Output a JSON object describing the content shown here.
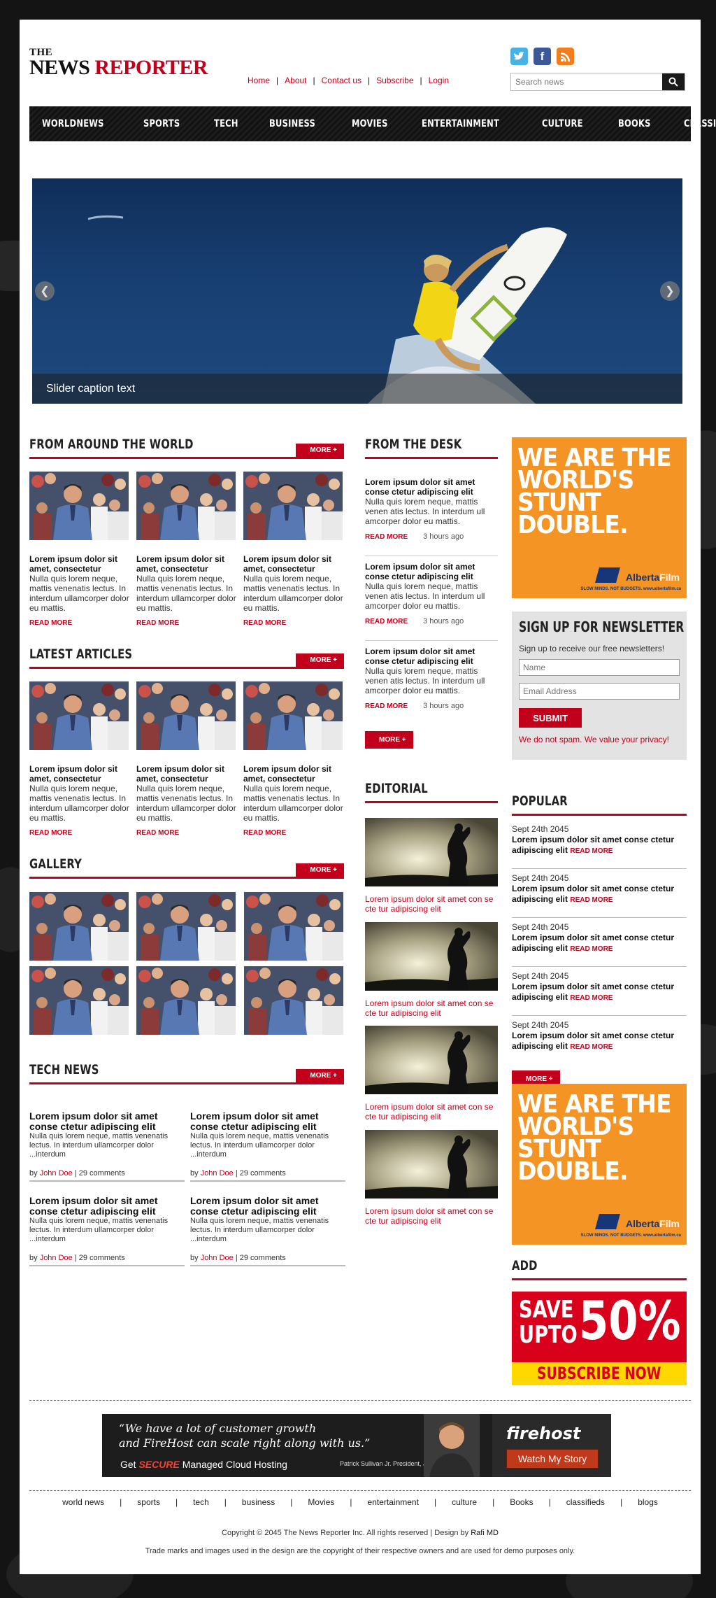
{
  "logo": {
    "the": "THE",
    "news": "NEWS",
    "reporter": "REPORTER"
  },
  "toplinks": [
    "Home",
    "About",
    "Contact us",
    "Subscribe",
    "Login"
  ],
  "social": {
    "twitter": "t",
    "facebook": "f",
    "rss": "rss"
  },
  "search": {
    "placeholder": "Search news"
  },
  "nav": [
    "WORLDNEWS",
    "SPORTS",
    "TECH",
    "BUSINESS",
    "MOVIES",
    "ENTERTAINMENT",
    "CULTURE",
    "BOOKS",
    "CLASSIFIEDS"
  ],
  "slider": {
    "caption": "Slider caption text",
    "prev": "❮",
    "next": "❯"
  },
  "more": "MORE +",
  "world": {
    "title": "FROM AROUND THE WORLD",
    "items": [
      {
        "h": "Lorem ipsum dolor sit amet, consectetur",
        "p": "Nulla quis lorem neque, mattis venenatis lectus. In interdum ullamcorper dolor eu mattis.",
        "rm": "READ MORE"
      },
      {
        "h": "Lorem ipsum dolor sit amet, consectetur",
        "p": "Nulla quis lorem neque, mattis venenatis lectus. In interdum ullamcorper dolor eu mattis.",
        "rm": "READ MORE"
      },
      {
        "h": "Lorem ipsum dolor sit amet, consectetur",
        "p": "Nulla quis lorem neque, mattis venenatis lectus. In interdum ullamcorper dolor eu mattis.",
        "rm": "READ MORE"
      }
    ]
  },
  "latest": {
    "title": "LATEST ARTICLES",
    "items": [
      {
        "h": "Lorem ipsum dolor sit amet, consectetur",
        "p": "Nulla quis lorem neque, mattis venenatis lectus. In interdum ullamcorper dolor eu mattis.",
        "rm": "READ MORE"
      },
      {
        "h": "Lorem ipsum dolor sit amet, consectetur",
        "p": "Nulla quis lorem neque, mattis venenatis lectus. In interdum ullamcorper dolor eu mattis.",
        "rm": "READ MORE"
      },
      {
        "h": "Lorem ipsum dolor sit amet, consectetur",
        "p": "Nulla quis lorem neque, mattis venenatis lectus. In interdum ullamcorper dolor eu mattis.",
        "rm": "READ MORE"
      }
    ]
  },
  "gallery": {
    "title": "GALLERY"
  },
  "tech": {
    "title": "TECH NEWS",
    "items": [
      {
        "h": "Lorem ipsum dolor sit amet conse ctetur adipiscing elit",
        "p": "Nulla quis lorem neque, mattis venenatis lectus. In interdum ullamcorper dolor ...interdum",
        "by": "by",
        "author": "John Doe",
        "comments": "| 29 comments"
      },
      {
        "h": "Lorem ipsum dolor sit amet conse ctetur adipiscing elit",
        "p": "Nulla quis lorem neque, mattis venenatis lectus. In interdum ullamcorper dolor ...interdum",
        "by": "by",
        "author": "John Doe",
        "comments": "| 29 comments"
      },
      {
        "h": "Lorem ipsum dolor sit amet conse ctetur adipiscing elit",
        "p": "Nulla quis lorem neque, mattis venenatis lectus. In interdum ullamcorper dolor ...interdum",
        "by": "by",
        "author": "John Doe",
        "comments": "| 29 comments"
      },
      {
        "h": "Lorem ipsum dolor sit amet conse ctetur adipiscing elit",
        "p": "Nulla quis lorem neque, mattis venenatis lectus. In interdum ullamcorper dolor ...interdum",
        "by": "by",
        "author": "John Doe",
        "comments": "| 29 comments"
      }
    ]
  },
  "desk": {
    "title": "FROM THE DESK",
    "items": [
      {
        "h": "Lorem ipsum dolor sit amet conse ctetur adipiscing elit",
        "p": "Nulla quis lorem neque, mattis venen atis lectus. In interdum ull amcorper dolor eu mattis.",
        "rm": "READ MORE",
        "ago": "3 hours ago"
      },
      {
        "h": "Lorem ipsum dolor sit amet conse ctetur adipiscing elit",
        "p": "Nulla quis lorem neque, mattis venen atis lectus. In interdum ull amcorper dolor eu mattis.",
        "rm": "READ MORE",
        "ago": "3 hours ago"
      },
      {
        "h": "Lorem ipsum dolor sit amet conse ctetur adipiscing elit",
        "p": "Nulla quis lorem neque, mattis venen atis lectus. In interdum ull amcorper dolor eu mattis.",
        "rm": "READ MORE",
        "ago": "3 hours ago"
      }
    ]
  },
  "editorial": {
    "title": "EDITORIAL",
    "items": [
      "Lorem ipsum dolor sit amet con se cte tur adipiscing elit",
      "Lorem ipsum dolor sit amet con se cte tur adipiscing elit",
      "Lorem ipsum dolor sit amet con se cte tur adipiscing elit",
      "Lorem ipsum dolor sit amet con se cte tur adipiscing elit"
    ]
  },
  "stunt": {
    "line1": "WE ARE THE",
    "line2": "WORLD'S",
    "line3": "STUNT",
    "line4": "DOUBLE.",
    "brand1": "Alberta",
    "brand2": "Film",
    "tag": "SLOW MINDS. NOT BUDGETS.  www.albertafilm.ca"
  },
  "newsletter": {
    "title": "SIGN UP FOR NEWSLETTER",
    "desc": "Sign up to receive our free newsletters!",
    "name_ph": "Name",
    "email_ph": "Email Address",
    "submit": "SUBMIT",
    "spam": "We do not spam. We value your privacy!"
  },
  "popular": {
    "title": "POPULAR",
    "items": [
      {
        "date": "Sept 24th 2045",
        "h": "Lorem ipsum dolor sit amet conse ctetur adipiscing elit",
        "rm": "READ MORE"
      },
      {
        "date": "Sept 24th 2045",
        "h": "Lorem ipsum dolor sit amet conse ctetur adipiscing elit",
        "rm": "READ MORE"
      },
      {
        "date": "Sept 24th 2045",
        "h": "Lorem ipsum dolor sit amet conse ctetur adipiscing elit",
        "rm": "READ MORE"
      },
      {
        "date": "Sept 24th 2045",
        "h": "Lorem ipsum dolor sit amet conse ctetur adipiscing elit",
        "rm": "READ MORE"
      },
      {
        "date": "Sept 24th 2045",
        "h": "Lorem ipsum dolor sit amet conse ctetur adipiscing elit",
        "rm": "READ MORE"
      }
    ]
  },
  "add": {
    "title": "ADD",
    "save": "SAVE",
    "upto": "UPTO",
    "pct": "50%",
    "subscribe": "SUBSCRIBE NOW"
  },
  "banner": {
    "quote1": "“We have a lot of customer growth",
    "quote2": "and FireHost can scale right along with us.”",
    "get": "Get ",
    "secure": "SECURE",
    "hosting": " Managed Cloud Hosting",
    "person": "Patrick Sullivan Jr.  President, Jigsaw Health",
    "brand": "firehost",
    "button": "Watch My Story"
  },
  "footer": {
    "links": [
      "world news",
      "sports",
      "tech",
      "business",
      "Movies",
      "entertainment",
      "culture",
      "Books",
      "classifieds",
      "blogs"
    ],
    "copy": "Copyright © 2045 The News Reporter Inc. All rights reserved | Design by ",
    "designer": "Rafi MD",
    "trade": "Trade marks and images used in the design are the copyright of their respective owners and are used for demo purposes only."
  },
  "colors": {
    "accent": "#c3001c",
    "nav": "#141414",
    "ad_orange": "#f39424",
    "sale_red": "#d8001a",
    "sale_yellow": "#ffd800"
  }
}
